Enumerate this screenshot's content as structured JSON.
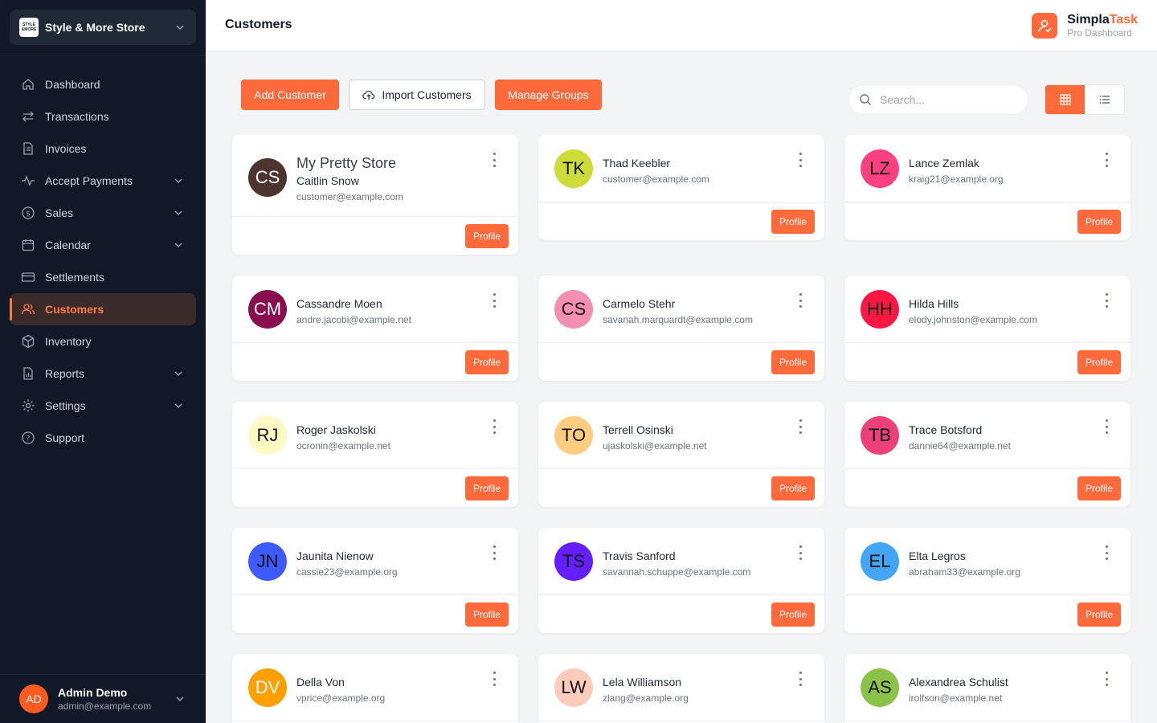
{
  "store": {
    "name": "Style & More Store",
    "logo_text": "STYLE & MORE"
  },
  "sidebar": {
    "items": [
      {
        "label": "Dashboard",
        "icon": "home-icon"
      },
      {
        "label": "Transactions",
        "icon": "arrows-icon"
      },
      {
        "label": "Invoices",
        "icon": "document-icon"
      },
      {
        "label": "Accept Payments",
        "icon": "pulse-icon"
      },
      {
        "label": "Sales",
        "icon": "dollar-icon"
      },
      {
        "label": "Calendar",
        "icon": "calendar-icon"
      },
      {
        "label": "Settlements",
        "icon": "card-icon"
      },
      {
        "label": "Customers",
        "icon": "users-icon"
      },
      {
        "label": "Inventory",
        "icon": "box-icon"
      },
      {
        "label": "Reports",
        "icon": "chart-icon"
      },
      {
        "label": "Settings",
        "icon": "gear-icon"
      },
      {
        "label": "Support",
        "icon": "help-icon"
      }
    ],
    "active": "Customers"
  },
  "user": {
    "initials": "AD",
    "name": "Admin Demo",
    "email": "admin@example.com"
  },
  "header": {
    "title": "Customers",
    "brand_main": "Simpla",
    "brand_accent": "Task",
    "brand_sub": "Pro Dashboard"
  },
  "toolbar": {
    "add_label": "Add Customer",
    "import_label": "Import Customers",
    "groups_label": "Manage Groups",
    "search_placeholder": "Search...",
    "view_mode": "grid"
  },
  "profile_label": "Profile",
  "customers": [
    {
      "store": "My Pretty Store",
      "initials": "CS",
      "name": "Caitlin Snow",
      "email": "customer@example.com",
      "color": "#4e342e",
      "text_color": "#ffffff"
    },
    {
      "initials": "TK",
      "name": "Thad Keebler",
      "email": "customer@example.com",
      "color": "#cddc39",
      "text_color": "#111111"
    },
    {
      "initials": "LZ",
      "name": "Lance Zemlak",
      "email": "kraig21@example.org",
      "color": "#ff4081",
      "text_color": "#111111"
    },
    {
      "initials": "CM",
      "name": "Cassandre Moen",
      "email": "andre.jacobi@example.net",
      "color": "#880e4f",
      "text_color": "#ffffff"
    },
    {
      "initials": "CS",
      "name": "Carmelo Stehr",
      "email": "savanah.marquardt@example.com",
      "color": "#f48fb1",
      "text_color": "#111111"
    },
    {
      "initials": "HH",
      "name": "Hilda Hills",
      "email": "elody.johnston@example.com",
      "color": "#ff1744",
      "text_color": "#111111"
    },
    {
      "initials": "RJ",
      "name": "Roger Jaskolski",
      "email": "ocronin@example.net",
      "color": "#fff9c4",
      "text_color": "#111111"
    },
    {
      "initials": "TO",
      "name": "Terrell Osinski",
      "email": "ujaskolski@example.net",
      "color": "#ffcc80",
      "text_color": "#111111"
    },
    {
      "initials": "TB",
      "name": "Trace Botsford",
      "email": "dannie64@example.net",
      "color": "#ec407a",
      "text_color": "#111111"
    },
    {
      "initials": "JN",
      "name": "Jaunita Nienow",
      "email": "cassie23@example.org",
      "color": "#3d5afe",
      "text_color": "#111111"
    },
    {
      "initials": "TS",
      "name": "Travis Sanford",
      "email": "savannah.schuppe@example.com",
      "color": "#651fff",
      "text_color": "#111111"
    },
    {
      "initials": "EL",
      "name": "Elta Legros",
      "email": "abraham33@example.org",
      "color": "#42a5f5",
      "text_color": "#111111"
    },
    {
      "initials": "DV",
      "name": "Della Von",
      "email": "vprice@example.org",
      "color": "#ffa000",
      "text_color": "#ffffff"
    },
    {
      "initials": "LW",
      "name": "Lela Williamson",
      "email": "zlang@example.org",
      "color": "#ffccbc",
      "text_color": "#111111"
    },
    {
      "initials": "AS",
      "name": "Alexandrea Schulist",
      "email": "irolfson@example.net",
      "color": "#8bc34a",
      "text_color": "#111111"
    }
  ]
}
